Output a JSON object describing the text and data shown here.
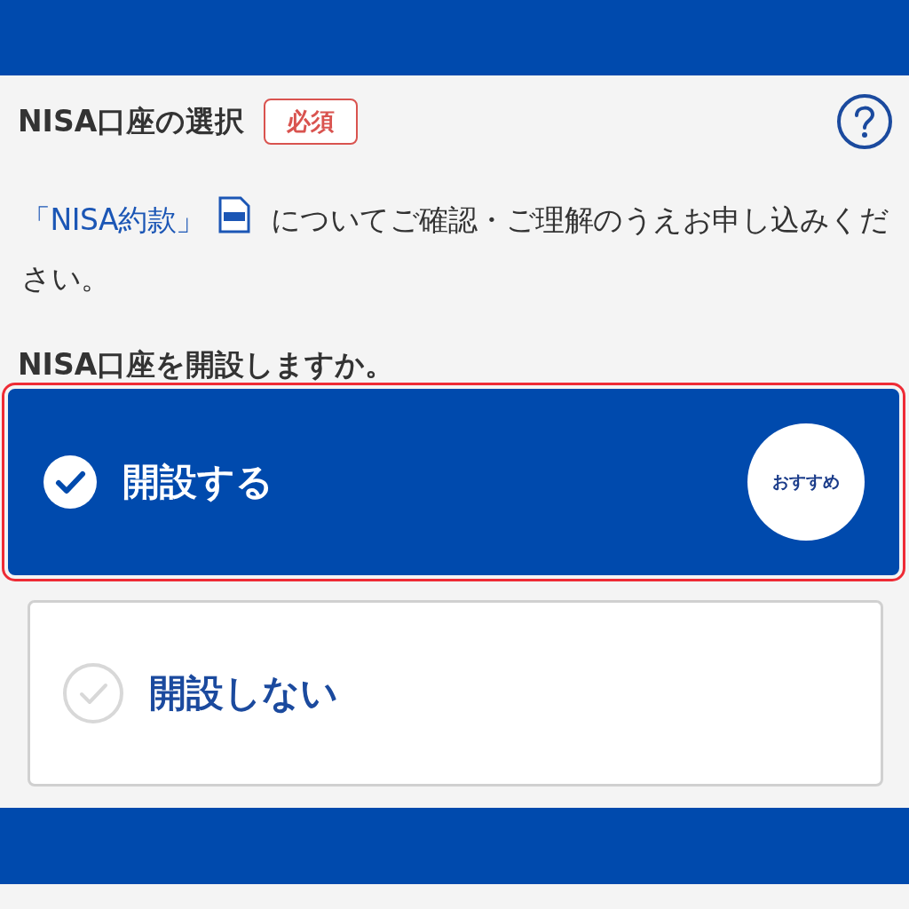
{
  "section": {
    "title": "NISA口座の選択",
    "required_badge": "必須"
  },
  "notice": {
    "link": "「NISA約款」",
    "text": "についてご確認・ご理解のうえお申し込みください。"
  },
  "question": "NISA口座を開設しますか。",
  "options": [
    {
      "label": "開設する",
      "selected": true,
      "highlighted": true,
      "badge": "おすすめ"
    },
    {
      "label": "開設しない",
      "selected": false,
      "highlighted": false
    }
  ]
}
